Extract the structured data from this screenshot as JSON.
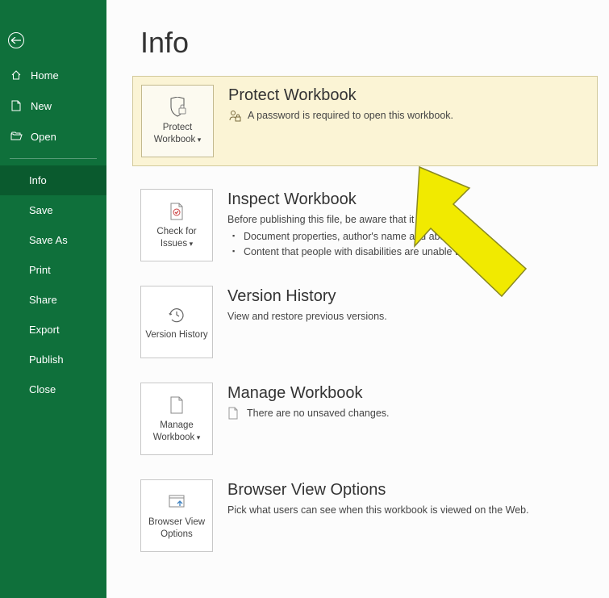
{
  "sidebar": {
    "nav_buttons": [
      {
        "label": "Home"
      },
      {
        "label": "New"
      },
      {
        "label": "Open"
      }
    ],
    "items": [
      {
        "label": "Info",
        "active": true
      },
      {
        "label": "Save"
      },
      {
        "label": "Save As"
      },
      {
        "label": "Print"
      },
      {
        "label": "Share"
      },
      {
        "label": "Export"
      },
      {
        "label": "Publish"
      },
      {
        "label": "Close"
      }
    ]
  },
  "page": {
    "title": "Info"
  },
  "sections": {
    "protect": {
      "title": "Protect Workbook",
      "desc": "A password is required to open this workbook.",
      "tile_label": "Protect Workbook",
      "has_dropdown": true
    },
    "inspect": {
      "title": "Inspect Workbook",
      "lead": "Before publishing this file, be aware that it contains:",
      "bullets": [
        "Document properties, author's name and absolute path",
        "Content that people with disabilities are unable to read"
      ],
      "tile_label": "Check for Issues",
      "has_dropdown": true
    },
    "version": {
      "title": "Version History",
      "desc": "View and restore previous versions.",
      "tile_label": "Version History"
    },
    "manage": {
      "title": "Manage Workbook",
      "desc": "There are no unsaved changes.",
      "tile_label": "Manage Workbook",
      "has_dropdown": true
    },
    "browser": {
      "title": "Browser View Options",
      "desc": "Pick what users can see when this workbook is viewed on the Web.",
      "tile_label": "Browser View Options"
    }
  }
}
